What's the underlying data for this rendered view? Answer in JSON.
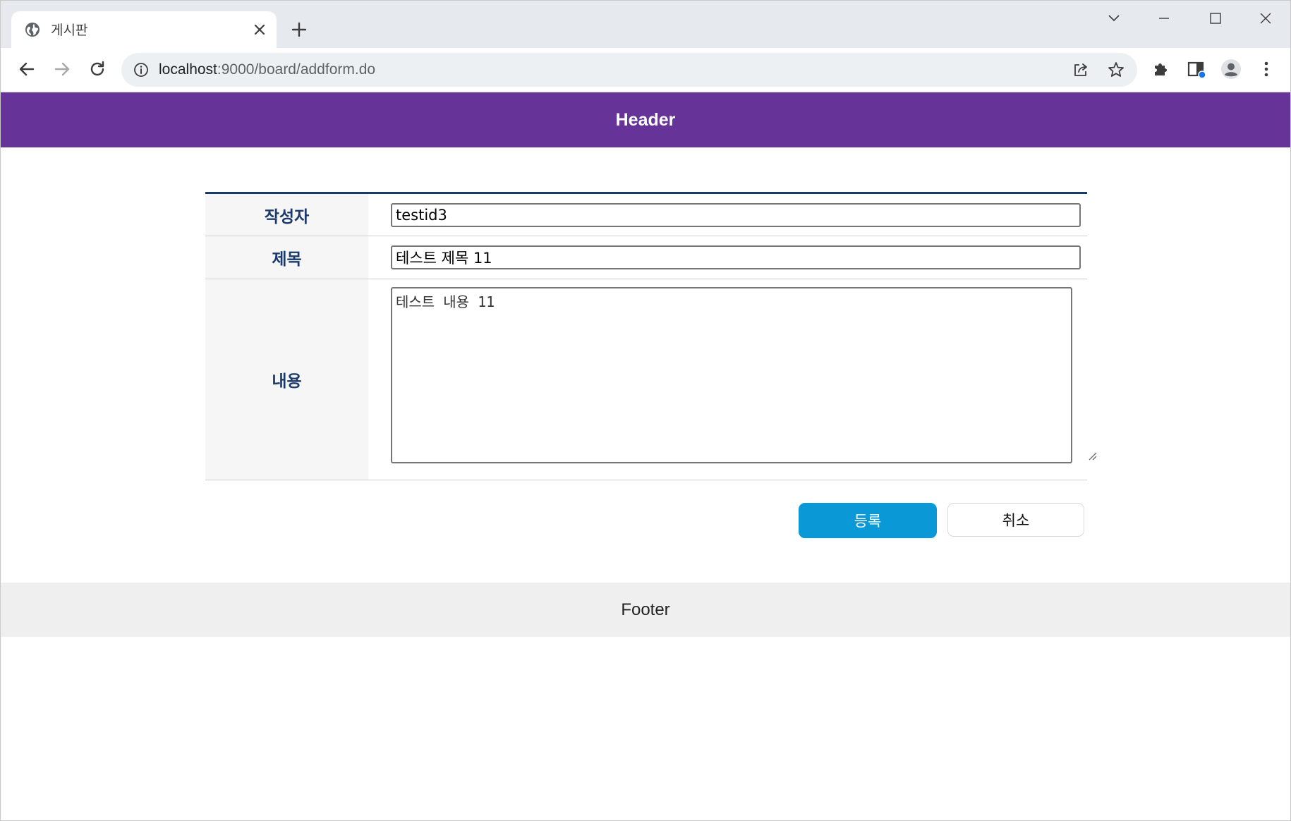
{
  "browser": {
    "tab": {
      "title": "게시판",
      "favicon": "globe-icon",
      "close": "close-icon"
    },
    "new_tab_icon": "plus-icon",
    "window_controls": [
      "chevron-down-icon",
      "minimize-icon",
      "maximize-icon",
      "close-icon"
    ],
    "toolbar": {
      "back": "arrow-left-icon",
      "forward": "arrow-right-icon",
      "reload": "reload-icon"
    },
    "omnibox": {
      "info_icon": "info-icon",
      "url_host": "localhost",
      "url_rest": ":9000/board/addform.do",
      "share_icon": "share-icon",
      "bookmark_icon": "star-icon"
    },
    "extensions_icon": "puzzle-icon",
    "side_panel_icon": "side-panel-icon",
    "profile_icon": "person-icon",
    "menu_icon": "kebab-menu-icon"
  },
  "header": {
    "title": "Header",
    "background": "#663399"
  },
  "form": {
    "writer_label": "작성자",
    "writer_value": "testid3",
    "title_label": "제목",
    "title_value": "테스트 제목 11",
    "content_label": "내용",
    "content_value": "테스트 내용 11",
    "accent": "#1b3a6b"
  },
  "buttons": {
    "submit_label": "등록",
    "cancel_label": "취소",
    "submit_color": "#0a99d6"
  },
  "footer": {
    "text": "Footer"
  }
}
